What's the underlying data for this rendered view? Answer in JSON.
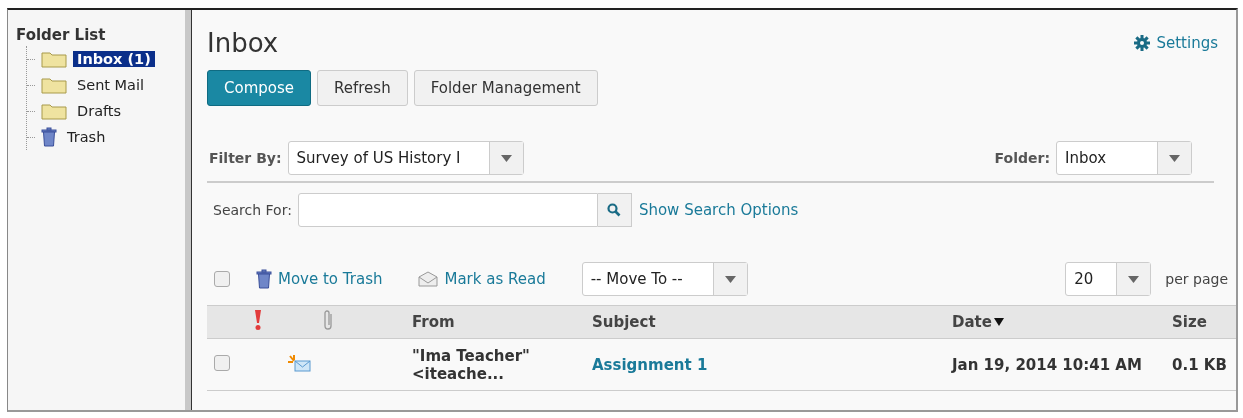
{
  "sidebar": {
    "title": "Folder List",
    "items": [
      {
        "label": "Inbox (1)",
        "kind": "folder",
        "selected": true
      },
      {
        "label": "Sent Mail",
        "kind": "folder",
        "selected": false
      },
      {
        "label": "Drafts",
        "kind": "folder",
        "selected": false
      },
      {
        "label": "Trash",
        "kind": "trash",
        "selected": false
      }
    ]
  },
  "header": {
    "title": "Inbox",
    "settings": "Settings"
  },
  "buttons": [
    {
      "label": "Compose",
      "primary": true
    },
    {
      "label": "Refresh",
      "primary": false
    },
    {
      "label": "Folder Management",
      "primary": false
    }
  ],
  "filter": {
    "label": "Filter By:",
    "value": "Survey of US History I"
  },
  "folder": {
    "label": "Folder:",
    "value": "Inbox"
  },
  "search": {
    "label": "Search For:",
    "options_link": "Show Search Options"
  },
  "toolbar": {
    "select_all_checked": false,
    "move_to_trash": "Move to Trash",
    "mark_as_read": "Mark as Read",
    "move_to": "-- Move To --",
    "page_size": "20",
    "per_page": "per page"
  },
  "table": {
    "columns": [
      {
        "kind": "priority"
      },
      {
        "kind": "attachment"
      },
      {
        "kind": "text",
        "label": "From"
      },
      {
        "kind": "text",
        "label": "Subject"
      },
      {
        "kind": "sorted",
        "label": "Date"
      },
      {
        "kind": "text",
        "label": "Size"
      }
    ],
    "rows": [
      {
        "checked": false,
        "unread": true,
        "from": "\"Ima Teacher\" <iteache...",
        "subject": "Assignment 1",
        "date": "Jan 19, 2014 10:41 AM",
        "size": "0.1 KB"
      }
    ]
  }
}
